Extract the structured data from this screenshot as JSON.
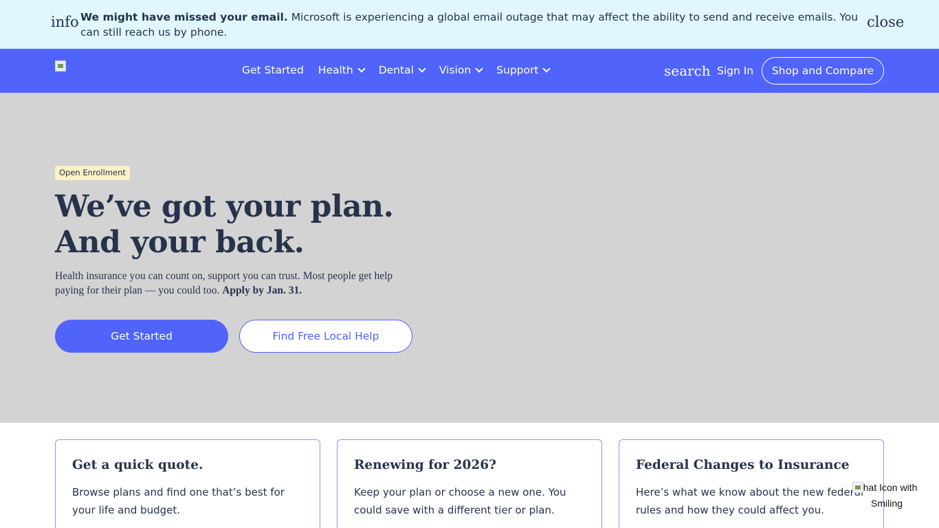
{
  "alert": {
    "icon": "info",
    "title": "We might have missed your email.",
    "message": "Microsoft is experiencing a global email outage that may affect the ability to send and receive emails. You can still reach us by phone.",
    "close_label": "close"
  },
  "header": {
    "nav": [
      {
        "label": "Get Started",
        "dropdown": false
      },
      {
        "label": "Health",
        "dropdown": true
      },
      {
        "label": "Dental",
        "dropdown": true
      },
      {
        "label": "Vision",
        "dropdown": true
      },
      {
        "label": "Support",
        "dropdown": true
      }
    ],
    "search_label": "search",
    "signin_label": "Sign In",
    "shop_label": "Shop and Compare"
  },
  "hero": {
    "badge": "Open Enrollment",
    "title_line1": "We’ve got your plan.",
    "title_line2": "And your back.",
    "subtitle": "Health insurance you can count on, support you can trust. Most people get help paying for their plan — you could too.",
    "subtitle_bold": "Apply by Jan. 31.",
    "primary_button": "Get Started",
    "secondary_button": "Find Free Local Help"
  },
  "cards": [
    {
      "title": "Get a quick quote.",
      "text": "Browse plans and find one that’s best for your life and budget."
    },
    {
      "title": "Renewing for 2026?",
      "text": "Keep your plan or choose a new one. You could save with a different tier or plan."
    },
    {
      "title": "Federal Changes to Insurance",
      "text": "Here’s what we know about the new federal rules and how they could affect you."
    }
  ],
  "chat": {
    "alt_text": "Chat Icon with Smiling"
  },
  "colors": {
    "primary": "#5063fa",
    "alert_bg": "#dff7fd",
    "hero_bg": "#d3d3d3",
    "badge_bg": "#fdf1c6",
    "text": "#27324b"
  }
}
